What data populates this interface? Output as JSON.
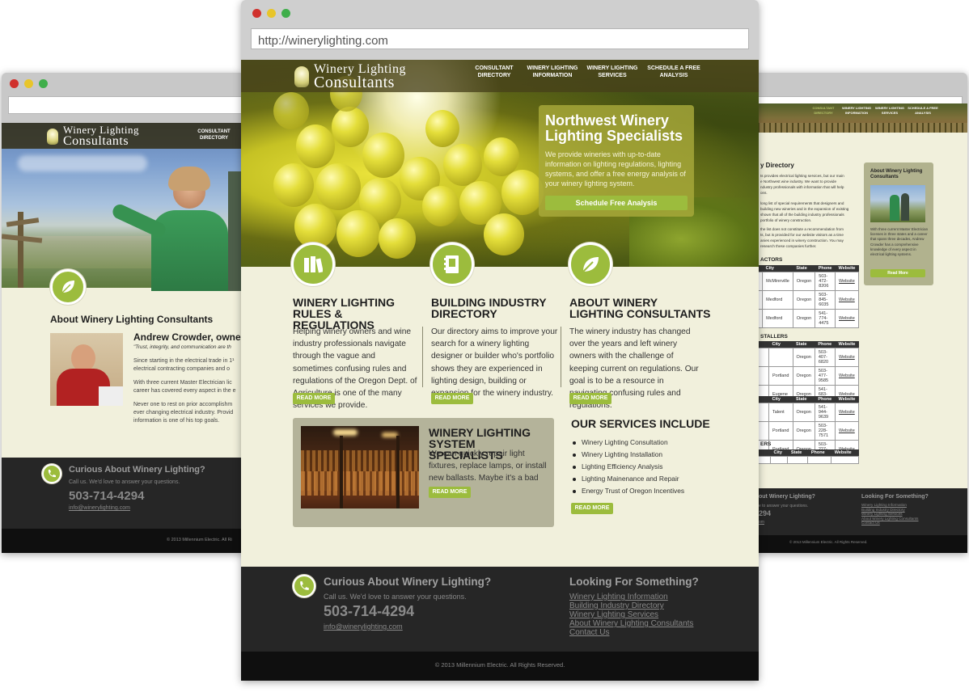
{
  "main_window": {
    "url": "http://winerylighting.com",
    "logo_line1": "Winery Lighting",
    "logo_line2": "Consultants",
    "nav": [
      {
        "l1": "CONSULTANT",
        "l2": "DIRECTORY"
      },
      {
        "l1": "WINERY LIGHTING",
        "l2": "INFORMATION"
      },
      {
        "l1": "WINERY LIGHTING",
        "l2": "SERVICES"
      },
      {
        "l1": "SCHEDULE A FREE",
        "l2": "ANALYSIS"
      }
    ],
    "hero": {
      "title_l1": "Northwest Winery",
      "title_l2": "Lighting Specialists",
      "text": "We provide wineries with up-to-date information on lighting regulations, lighting systems, and offer a free energy analysis of your winery lighting system.",
      "button": "Schedule Free Analysis"
    },
    "columns": [
      {
        "title_l1": "WINERY LIGHTING",
        "title_l2": "RULES & REGULATIONS",
        "text": "Helping winery owners and wine industry professionals navigate through the vague and sometimes confusing rules and regulations of the Oregon Dept. of Agriculture is one of the many services we provide.",
        "button": "READ MORE",
        "icon": "books-icon"
      },
      {
        "title_l1": "BUILDING INDUSTRY",
        "title_l2": "DIRECTORY",
        "text": "Our directory aims to improve your search for a winery lighting designer or builder who's portfolio shows they are experienced in lighting design, building or expansion for the winery industry.",
        "button": "READ MORE",
        "icon": "address-book-icon"
      },
      {
        "title_l1": "ABOUT WINERY",
        "title_l2": "LIGHTING CONSULTANTS",
        "text": "The winery industry has changed over the years and left winery owners with the challenge of keeping current on regulations. Our goal is to be a resource in navigating confusing rules and regulations.",
        "button": "READ MORE",
        "icon": "leaf-icon"
      }
    ],
    "system": {
      "title_l1": "WINERY LIGHTING",
      "title_l2": "SYSTEM SPECIALISTS",
      "text": "We can quickly repair light fixtures, replace lamps, or install new ballasts. Maybe it's a bad switch...",
      "button": "READ MORE"
    },
    "services": {
      "title": "OUR SERVICES INCLUDE",
      "items": [
        "Winery Lighting Consultation",
        "Winery Lighting Installation",
        "Lighting Efficiency Analysis",
        "Lighting Mainenance and Repair",
        "Energy Trust of Oregon Incentives"
      ],
      "button": "READ MORE"
    },
    "footer": {
      "curious_title": "Curious About Winery Lighting?",
      "curious_sub": "Call us. We'd love to answer your questions.",
      "phone": "503-714-4294",
      "email": "info@winerylighting.com",
      "looking_title": "Looking For Something?",
      "links": [
        "Winery Lighting Information",
        "Building Industry Directory",
        "Winery Lighting Services",
        "About Winery Lighting Consultants",
        "Contact Us"
      ],
      "copyright": "© 2013 Millennium Electric. All Rights Reserved."
    }
  },
  "left_window": {
    "logo_line1": "Winery Lighting",
    "logo_line2": "Consultants",
    "nav_l1": "CONSULTANT",
    "nav_l2": "DIRECTORY",
    "about_title": "About Winery Lighting Consultants",
    "person_name": "Andrew Crowder, owner",
    "quote": "\"Trust, integrity, and communication are th",
    "p1": "Since starting in the electrical trade in 1¹ electrical contracting companies and o",
    "p2": "With three current Master Electrician lic career has covered every aspect in the e",
    "p3": "Never one to rest on prior accomplishm ever changing electrical industry. Provid information is one of his top goals.",
    "footer_title": "Curious About Winery Lighting?",
    "footer_sub": "Call us. We'd love to answer your questions.",
    "phone": "503-714-4294",
    "email": "info@winerylighting.com",
    "copyright": "© 2013 Millennium Electric. All Ri"
  },
  "right_window": {
    "nav": [
      "CONSULTANT DIRECTORY",
      "WINERY LIGHTING INFORMATION",
      "WINERY LIGHTING SERVICES",
      "SCHEDULE A FREE ANALYSIS"
    ],
    "heading": "y Directory",
    "intro": [
      "ts provides electrical lighting services, but our main",
      "e Northwest wine industry. We want to provide",
      "ndustry professionals with information that will help",
      "ons."
    ],
    "intro2": [
      "long list of special requirements that designers and",
      "building new wineries and in the expansion of existing",
      "shown that all of the building industry professionals",
      "portfolio of winery construction."
    ],
    "intro3": [
      "the list does not constitute a recommendation from",
      "ts, but is provided for our website visitors as a time",
      "anies experienced in winery construction. You may",
      "research these companies further."
    ],
    "sections": [
      {
        "title": "ACTORS",
        "headers": [
          "City",
          "State",
          "Phone",
          "Website"
        ],
        "rows": [
          [
            "n",
            "McMinnville",
            "Oregon",
            "503-472-8206",
            "Website"
          ],
          [
            "",
            "Medford",
            "Oregon",
            "503-845-6035",
            "Website"
          ],
          [
            "",
            "Medford",
            "Oregon",
            "541-774-4475",
            "Website"
          ]
        ]
      },
      {
        "title": "STALLERS",
        "headers": [
          "City",
          "State",
          "Phone",
          "Website"
        ],
        "rows": [
          [
            "",
            "",
            "Oregon",
            "503-407-6820",
            "Website"
          ],
          [
            "",
            "Portland",
            "Oregon",
            "503-477-9585",
            "Website"
          ],
          [
            "s",
            "Eugene",
            "Oregon",
            "541-683-2345",
            "Website"
          ]
        ]
      },
      {
        "title": "",
        "headers": [
          "City",
          "State",
          "Phone",
          "Website"
        ],
        "rows": [
          [
            "",
            "Talent",
            "Oregon",
            "541-944-9639",
            "Website"
          ],
          [
            "",
            "Portland",
            "Oregon",
            "503-228-7571",
            "Website"
          ],
          [
            "e",
            "Portland",
            "Oregon",
            "503-227-1737",
            "Website"
          ]
        ]
      },
      {
        "title": "ERS",
        "headers": [
          "",
          "City",
          "State",
          "Phone",
          "Website"
        ],
        "rows": [
          [
            "",
            "",
            "",
            "",
            ""
          ]
        ]
      }
    ],
    "sidebar_title": "About Winery Lighting Consultants",
    "sidebar_text": "With three current Master Electrician licenses in three states and a career that spans three decades, Andrew Crowder has a comprehensive knowledge of every aspect in electrical lighting systems.",
    "sidebar_button": "Read More",
    "footer_left": "out Winery Lighting?",
    "footer_sub": "e to answer your questions.",
    "phone": "294",
    "email": "om",
    "looking_title": "Looking For Something?",
    "links": [
      "Winery Lighting Information",
      "Building Industry Directory",
      "Winery Lighting Services",
      "About Winery Lighting Consultants",
      "Contact Us"
    ],
    "copyright": "© 2013 Millennium Electric. All Rights Reserved."
  }
}
